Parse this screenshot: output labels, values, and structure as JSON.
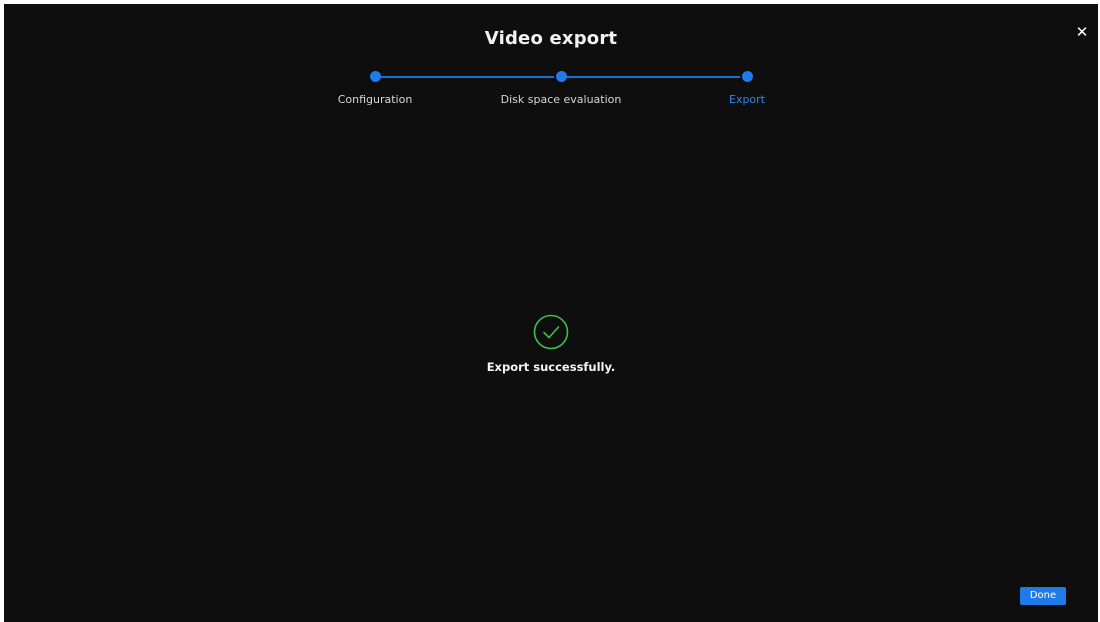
{
  "dialog": {
    "title": "Video export",
    "close_icon": "close-icon",
    "close_glyph": "✕"
  },
  "stepper": {
    "steps": [
      {
        "label": "Configuration",
        "state": "completed"
      },
      {
        "label": "Disk space evaluation",
        "state": "completed"
      },
      {
        "label": "Export",
        "state": "active"
      }
    ]
  },
  "result": {
    "icon": "check-circle-icon",
    "message": "Export successfully."
  },
  "footer": {
    "done_label": "Done"
  },
  "colors": {
    "background": "#0e0e0f",
    "accent": "#1f7be8",
    "success": "#3fbf4a",
    "text": "#ffffff"
  }
}
